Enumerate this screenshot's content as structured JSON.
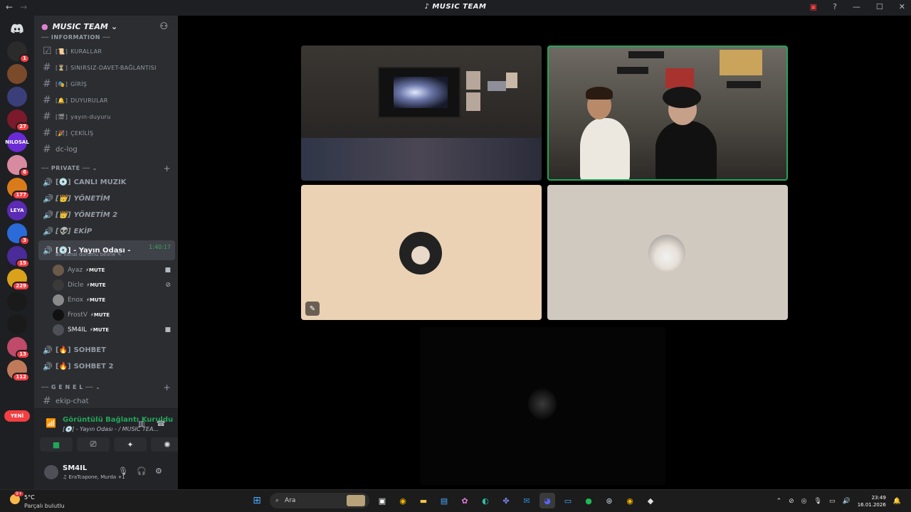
{
  "window": {
    "title": "MUSIC TEAM",
    "back_glyph": "←",
    "forward_glyph": "→",
    "controls": [
      "▣",
      "?",
      "—",
      "☐",
      "✕"
    ]
  },
  "rail": {
    "servers": [
      {
        "label": "",
        "badge": "1",
        "color": "#2b2b2b"
      },
      {
        "label": "",
        "badge": "",
        "color": "#7a4a2a"
      },
      {
        "label": "",
        "badge": "",
        "color": "#3a3f7a"
      },
      {
        "label": "",
        "badge": "27",
        "color": "#7a1a2a"
      },
      {
        "label": "NILOSAL",
        "badge": "",
        "color": "#6a2bd6"
      },
      {
        "label": "",
        "badge": "6",
        "color": "#d88aa0"
      },
      {
        "label": "",
        "badge": "177",
        "color": "#d97b1a"
      },
      {
        "label": "LEYA",
        "badge": "",
        "color": "#5b2bb6"
      },
      {
        "label": "",
        "badge": "3",
        "color": "#2a6ad9"
      },
      {
        "label": "",
        "badge": "15",
        "color": "#4b2a9a"
      },
      {
        "label": "",
        "badge": "229",
        "color": "#d9a21a"
      },
      {
        "label": "",
        "badge": "",
        "color": "#1a1a1a"
      },
      {
        "label": "",
        "badge": "",
        "color": "#1a1a1a"
      },
      {
        "label": "",
        "badge": "13",
        "color": "#c04a6a"
      },
      {
        "label": "",
        "badge": "112",
        "color": "#c07a5a"
      }
    ],
    "new_label": "YENİ"
  },
  "server": {
    "name": "MUSIC TEAM",
    "categories": [
      {
        "name": "INFORMATION"
      },
      {
        "name": "PRIVATE"
      },
      {
        "name": "G E N E L"
      }
    ],
    "text_channels": [
      {
        "name": "KURALLAR",
        "emoji": "📜"
      },
      {
        "name": "SINIRSIZ-DAVET-BAĞLANTISI",
        "emoji": "⏳"
      },
      {
        "name": "GİRİŞ",
        "emoji": "🎭"
      },
      {
        "name": "DUYURULAR",
        "emoji": "🔔"
      },
      {
        "name": "yayın-duyuru",
        "emoji": "🎬"
      },
      {
        "name": "ÇEKİLİŞ",
        "emoji": "🎉"
      },
      {
        "name": "dc-log",
        "emoji": ""
      }
    ],
    "voice_channels": [
      {
        "name": "CANLI MUZIK",
        "emoji": "💿"
      },
      {
        "name": "YÖNETİM",
        "emoji": "👑"
      },
      {
        "name": "YÖNETİM 2",
        "emoji": "👑"
      },
      {
        "name": "EKİP",
        "emoji": "👽"
      }
    ],
    "active_channel": {
      "name": "- Yayın Odası -",
      "emoji": "💿",
      "timer": "1:40:17",
      "status_placeholder": "Bir kanal durumu belirle"
    },
    "members": [
      {
        "name": "Ayaz",
        "tag": "MUTE",
        "icon": "video-icon",
        "color": "#6b5a4a"
      },
      {
        "name": "Dicle",
        "tag": "MUTE",
        "icon": "deafened-icon",
        "color": "#3a3a3a"
      },
      {
        "name": "Enox",
        "tag": "MUTE",
        "icon": "",
        "color": "#8a8a8a"
      },
      {
        "name": "FrostV",
        "tag": "MUTE",
        "icon": "",
        "color": "#111"
      },
      {
        "name": "SM4IL",
        "tag": "MUTE",
        "icon": "video-icon",
        "color": "#4e5058"
      }
    ],
    "more_voice": [
      {
        "name": "SOHBET",
        "emoji": "🔥"
      },
      {
        "name": "SOHBET 2",
        "emoji": "🔥"
      }
    ],
    "general_channels": [
      {
        "name": "ekip-chat"
      }
    ]
  },
  "voice_panel": {
    "status": "Görüntülü Bağlantı Kuruldu",
    "location": "[💿] - Yayın Odası - / MUSIC TEA..."
  },
  "user_panel": {
    "username": "SM4IL",
    "status": "EraTcapone, Murda +1"
  },
  "taskbar": {
    "weather_temp": "5°C",
    "weather_cond": "Parçalı bulutlu",
    "weather_badge": "9+",
    "search_placeholder": "Ara",
    "time": "23:49",
    "date": "16.01.2026"
  },
  "colors": {
    "accent_green": "#23a55a",
    "sidebar_bg": "#2b2d31",
    "rail_bg": "#1e1f22",
    "badge_red": "#f23f43"
  }
}
